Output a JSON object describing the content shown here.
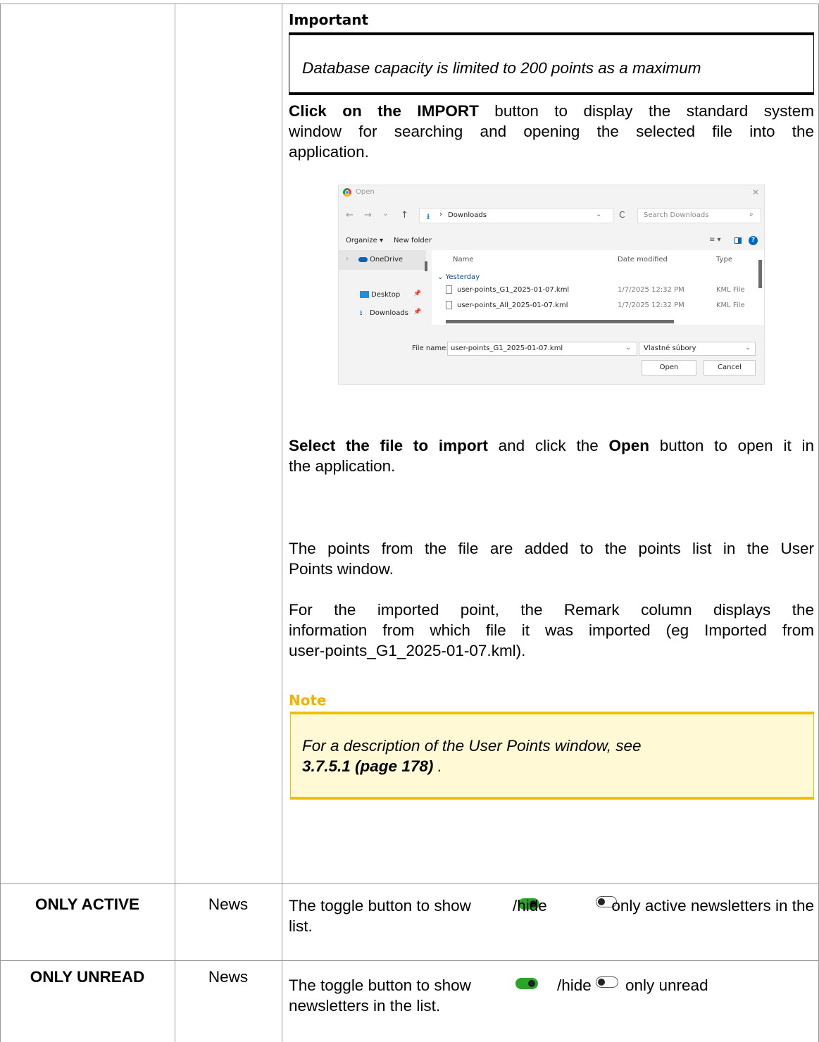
{
  "important": {
    "title": "Important",
    "text": "Database capacity is limited to 200 points as a maximum"
  },
  "paragraphs": {
    "import_intro_bold": "Click on the IMPORT",
    "import_intro_rest_1": " button to display the standard system",
    "import_intro_rest_2": "window for searching and opening the selected file into the",
    "import_intro_rest_3": "application.",
    "select_bold": "Select the file to import",
    "select_mid": " and click the ",
    "select_open_bold": "Open",
    "select_rest_1": " button to open it in",
    "select_rest_2": "the application.",
    "points_added_1": "The points from the file are added to the points list in the User",
    "points_added_2": "Points window.",
    "remark_1": "For the imported point, the Remark column displays the",
    "remark_2": "information from which file it was imported (eg Imported from",
    "remark_3": "user-points_G1_2025-01-07.kml)."
  },
  "note": {
    "title": "Note",
    "text_1": "For a description of the User Points window, see",
    "ref_bold": "3.7.5.1 (page 178)",
    "ref_end": " ."
  },
  "dialog": {
    "title": "Open",
    "close_glyph": "✕",
    "nav_back": "←",
    "nav_forward": "→",
    "nav_recent": "⌄",
    "nav_up": "↑",
    "path_sep": "›",
    "path_folder": "Downloads",
    "refresh": "C",
    "search_placeholder": "Search Downloads",
    "organize": "Organize ▾",
    "new_folder": "New folder",
    "view_options": "≡ ▾",
    "help": "?",
    "sidebar": {
      "onedrive": "OneDrive",
      "desktop": "Desktop",
      "downloads": "Downloads"
    },
    "columns": {
      "name": "Name",
      "date": "Date modified",
      "type": "Type"
    },
    "group": "Yesterday",
    "files": [
      {
        "name": "user-points_G1_2025-01-07.kml",
        "date": "1/7/2025 12:32 PM",
        "type": "KML File"
      },
      {
        "name": "user-points_All_2025-01-07.kml",
        "date": "1/7/2025 12:32 PM",
        "type": "KML File"
      }
    ],
    "file_name_label": "File name:",
    "file_name_value": "user-points_G1_2025-01-07.kml",
    "file_type": "Vlastné súbory",
    "open_button": "Open",
    "cancel_button": "Cancel",
    "colors": {
      "chrome_red": "#db4437",
      "accent": "#0067c0",
      "onedrive": "#0364b8"
    }
  },
  "rows": [
    {
      "label": "ONLY ACTIVE",
      "context": "News",
      "text_1": "The toggle button to show",
      "text_hide": "/hide",
      "text_2": "only active newsletters in the",
      "text_3": "list.",
      "toggle_on_color": "#2aa52a"
    },
    {
      "label": "ONLY UNREAD",
      "context": "News",
      "text_1": "The toggle button to show",
      "text_hide": "/hide",
      "text_2": "only unread",
      "text_3": "newsletters in the list.",
      "toggle_on_color": "#2aa52a"
    }
  ]
}
